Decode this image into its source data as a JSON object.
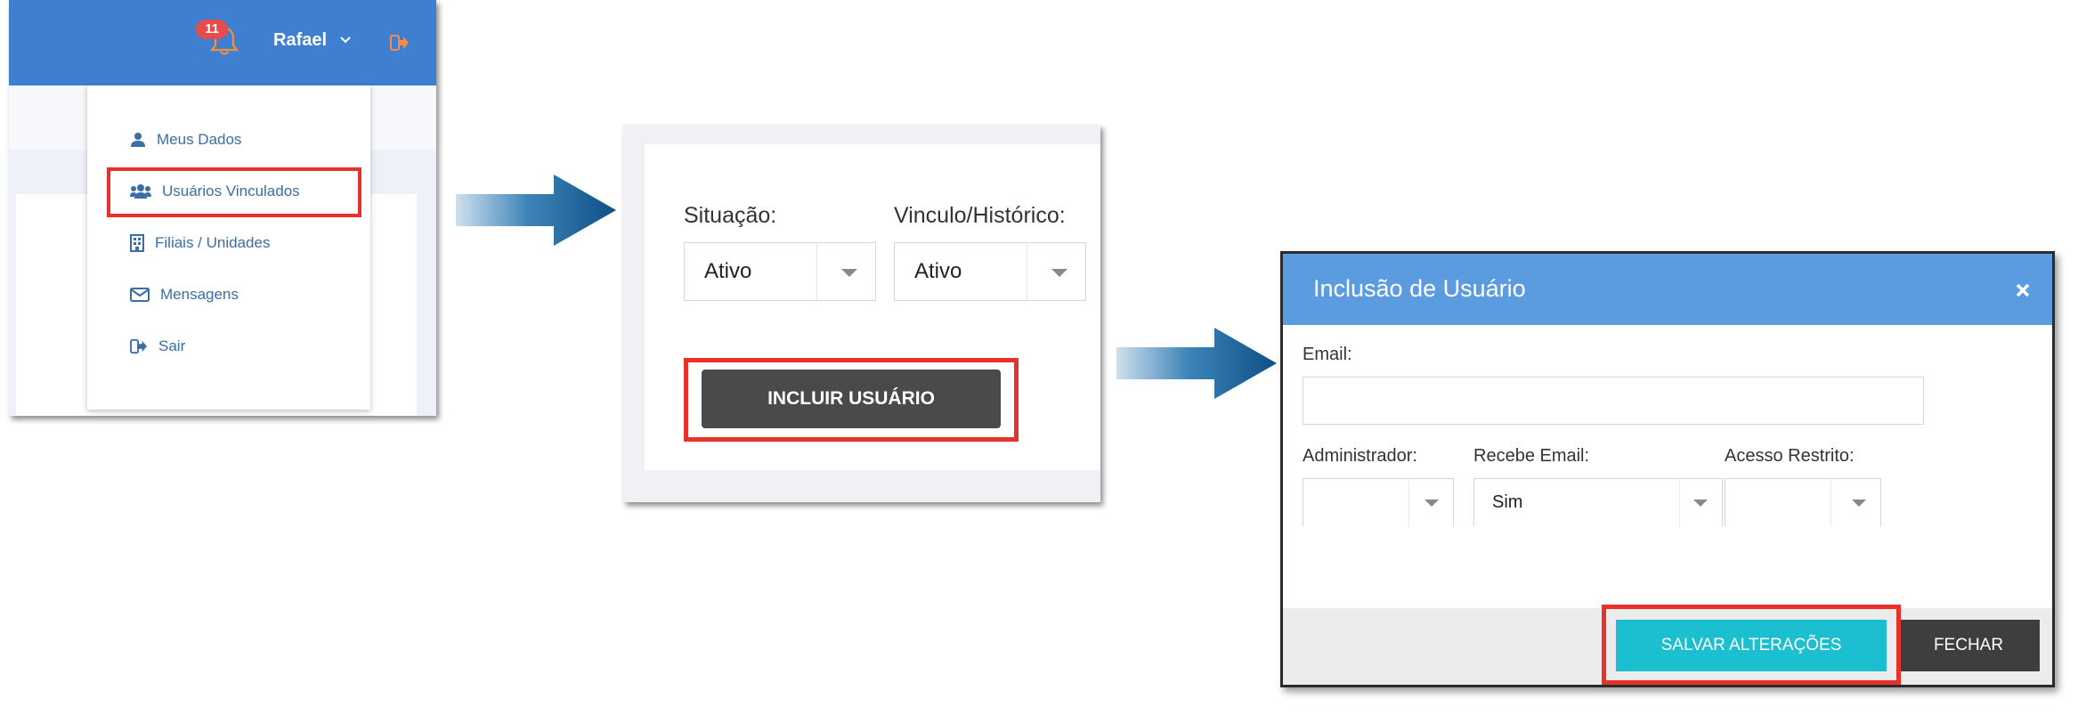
{
  "panel1": {
    "header": {
      "notification_count": "11",
      "user_name": "Rafael",
      "colors": {
        "topbar": "#3f7fd0",
        "badge": "#e84b4b",
        "logout": "#ff8a3d"
      }
    },
    "menu": [
      {
        "label": "Meus Dados",
        "icon": "user-icon"
      },
      {
        "label": "Usuários Vinculados",
        "icon": "users-icon",
        "highlighted": true
      },
      {
        "label": "Filiais / Unidades",
        "icon": "building-icon"
      },
      {
        "label": "Mensagens",
        "icon": "envelope-icon"
      },
      {
        "label": "Sair",
        "icon": "sign-out-icon"
      }
    ]
  },
  "panel2": {
    "situacao": {
      "label": "Situação:",
      "value": "Ativo"
    },
    "vinculo": {
      "label": "Vinculo/Histórico:",
      "value": "Ativo"
    },
    "incluir_button": "INCLUIR USUÁRIO"
  },
  "panel3": {
    "title": "Inclusão de Usuário",
    "email_label": "Email:",
    "email_value": "",
    "administrador": {
      "label": "Administrador:",
      "value": ""
    },
    "recebe_email": {
      "label": "Recebe Email:",
      "value": "Sim"
    },
    "acesso_restrito": {
      "label": "Acesso Restrito:",
      "value": ""
    },
    "save_button": "SALVAR ALTERAÇÕES",
    "close_button": "FECHAR",
    "colors": {
      "header": "#5b9be0",
      "save": "#1bbfd0",
      "close": "#3e3e3e",
      "highlight": "#e8312b"
    }
  }
}
